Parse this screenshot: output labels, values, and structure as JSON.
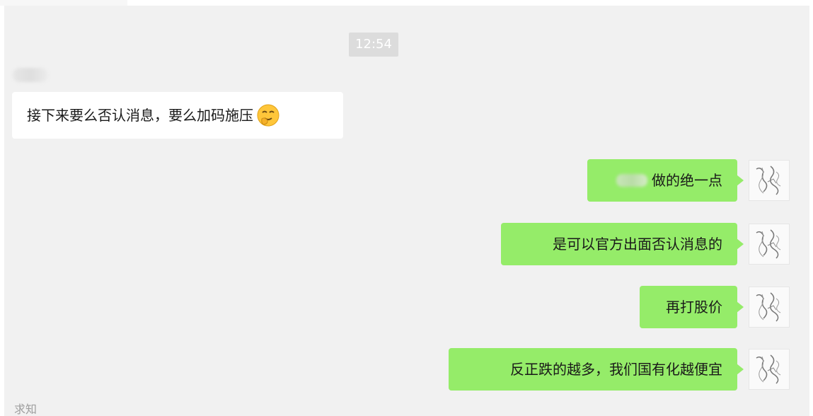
{
  "chat": {
    "timestamp": "12:54",
    "messages": [
      {
        "direction": "incoming",
        "text": "接下来要么否认消息，要么加码施压",
        "emoji": "grinning-face-with-hand-emoji"
      },
      {
        "direction": "outgoing",
        "text": "做的绝一点",
        "redacted_prefix": true
      },
      {
        "direction": "outgoing",
        "text": "是可以官方出面否认消息的"
      },
      {
        "direction": "outgoing",
        "text": "再打股价"
      },
      {
        "direction": "outgoing",
        "text": "反正跌的越多，我们国有化越便宜"
      }
    ],
    "bottom_label": "求知"
  },
  "colors": {
    "chat_background": "#f1f1f1",
    "outgoing_bubble": "#95ec69",
    "incoming_bubble": "#ffffff",
    "timestamp_background": "#dcdcdc"
  }
}
